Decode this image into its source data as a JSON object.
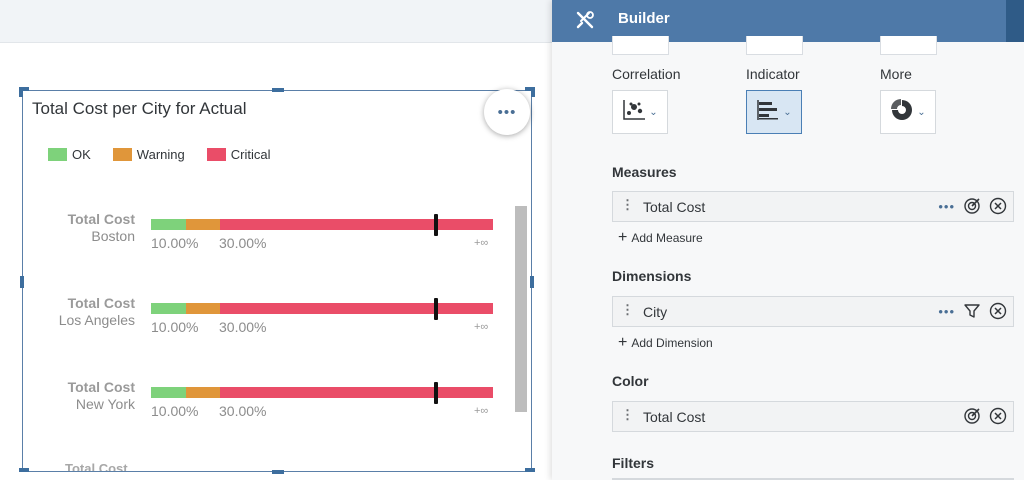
{
  "chart": {
    "title": "Total Cost per City for Actual",
    "more_label": "•••",
    "legend": [
      {
        "label": "OK",
        "color": "#7ed27b"
      },
      {
        "label": "Warning",
        "color": "#e0963a"
      },
      {
        "label": "Critical",
        "color": "#ea4d68"
      }
    ],
    "rows": [
      {
        "measure": "Total Cost",
        "city": "Boston",
        "tick1": "10.00%",
        "tick2": "30.00%",
        "inf": "+∞"
      },
      {
        "measure": "Total Cost",
        "city": "Los Angeles",
        "tick1": "10.00%",
        "tick2": "30.00%",
        "inf": "+∞"
      },
      {
        "measure": "Total Cost",
        "city": "New York",
        "tick1": "10.00%",
        "tick2": "30.00%",
        "inf": "+∞"
      }
    ],
    "cut_row": "Total Cost"
  },
  "chart_data": {
    "type": "bar",
    "title": "Total Cost per City for Actual",
    "categories": [
      "Boston",
      "Los Angeles",
      "New York"
    ],
    "ranges": [
      {
        "name": "OK",
        "from": 0,
        "to": 10.0
      },
      {
        "name": "Warning",
        "from": 10.0,
        "to": 30.0
      },
      {
        "name": "Critical",
        "from": 30.0,
        "to": "+∞"
      }
    ],
    "tick_labels": [
      "10.00%",
      "30.00%",
      "+∞"
    ]
  },
  "builder": {
    "title": "Builder",
    "categories": [
      {
        "label": "Correlation",
        "icon": "scatter-chart-icon"
      },
      {
        "label": "Indicator",
        "icon": "bullet-chart-icon"
      },
      {
        "label": "More",
        "icon": "donut-chart-icon"
      }
    ],
    "measures": {
      "heading": "Measures",
      "field": "Total Cost",
      "add_label": "Add Measure"
    },
    "dimensions": {
      "heading": "Dimensions",
      "field": "City",
      "add_label": "Add Dimension"
    },
    "color": {
      "heading": "Color",
      "field": "Total Cost"
    },
    "filters": {
      "heading": "Filters"
    },
    "accent": "#4e79a8"
  }
}
